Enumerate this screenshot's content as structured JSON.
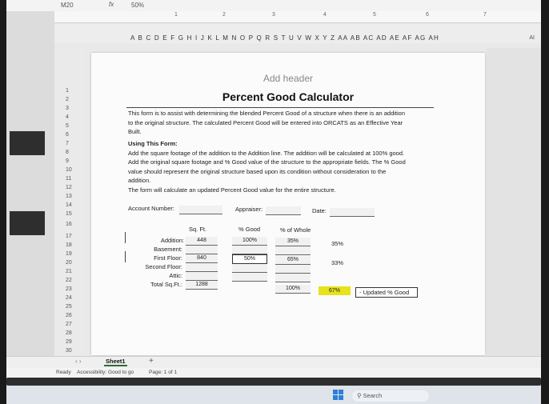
{
  "formula_bar": {
    "cell_ref": "M20",
    "fx": "fx",
    "value": "50%"
  },
  "ruler": {
    "numbers": [
      "1",
      "2",
      "3",
      "4",
      "5",
      "6",
      "7"
    ]
  },
  "column_letters": "A B C D E F G H I J K L M N O P Q R S T U V W X Y Z AA AB AC AD AE AF AG AH",
  "column_right": "AI",
  "rows": [
    "1",
    "2",
    "3",
    "4",
    "5",
    "6",
    "7",
    "8",
    "9",
    "10",
    "11",
    "12",
    "13",
    "14",
    "15",
    "16",
    "17",
    "18",
    "19",
    "20",
    "21",
    "22",
    "23",
    "24",
    "25",
    "26",
    "27",
    "28",
    "29",
    "30"
  ],
  "page": {
    "header_placeholder": "Add header",
    "title": "Percent Good Calculator",
    "intro": [
      "This form is to assist with determining the blended Percent Good of a structure when there is an addition",
      "to the original structure. The calculated Percent Good will be entered into ORCATS as an Effective Year",
      "Built."
    ],
    "using_title": "Using This Form:",
    "using_lines": [
      "Add the square footage of the addition to the Addition line. The addition will be calculated at 100% good.",
      "Add the original square footage and % Good value of the structure to the appropriate fields. The % Good",
      "value should represent the original structure based upon its condition without consideration to the",
      "addition.",
      "The form will calculate an updated Percent Good value for the entire structure."
    ],
    "account_label": "Account Number:",
    "appraiser_label": "Appraiser:",
    "date_label": "Date:",
    "col_sqft": "Sq. Ft.",
    "col_good": "% Good",
    "col_whole": "% of Whole",
    "addition_label": "Addition:",
    "basement_label": "Basement:",
    "first_floor_label": "First Floor:",
    "second_floor_label": "Second Floor:",
    "attic_label": "Attic:",
    "total_label": "Total Sq.Ft.:",
    "addition_sqft": "448",
    "addition_good": "100%",
    "addition_whole": "35%",
    "addition_contrib": "35%",
    "first_sqft": "840",
    "first_good": "50%",
    "first_whole": "65%",
    "first_contrib": "33%",
    "total_sqft": "1288",
    "total_whole": "100%",
    "result": "67%",
    "updated_label": "- Updated % Good"
  },
  "sheet_tab": "Sheet1",
  "status": {
    "ready": "Ready",
    "accessibility": "Accessibility: Good to go",
    "page": "Page: 1 of 1"
  },
  "taskbar": {
    "search": "Search"
  },
  "colors": {
    "highlight": "#e6e21c",
    "windows_blue": "#2d7fd9",
    "sheet_tab_green": "#2d6b3c"
  }
}
